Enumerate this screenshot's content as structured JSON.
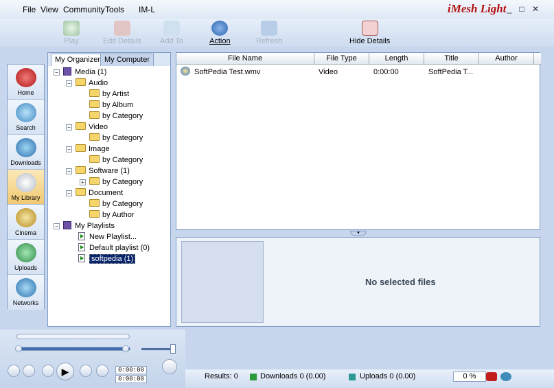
{
  "menu": {
    "file": "File",
    "view": "View",
    "community": "Community",
    "tools": "Tools",
    "iml": "IM-L"
  },
  "brand": "iMesh Light",
  "window": {
    "minimize": "_",
    "maximize": "□",
    "close": "✕"
  },
  "toolbar": {
    "play": "Play",
    "edit_details": "Edit Details",
    "add_to": "Add To",
    "action": "Action",
    "refresh": "Refresh",
    "hide_details": "Hide Details"
  },
  "nav": [
    "Home",
    "Search",
    "Downloads",
    "My Library",
    "Cinema",
    "Uploads",
    "Networks"
  ],
  "tabs": {
    "organizer": "My Organizer",
    "computer": "My Computer"
  },
  "tree": {
    "media": "Media (1)",
    "audio": "Audio",
    "by_artist": "by Artist",
    "by_album": "by Album",
    "by_category": "by Category",
    "video": "Video",
    "image": "Image",
    "software": "Software (1)",
    "document": "Document",
    "by_author": "by Author",
    "playlists": "My Playlists",
    "new_playlist": "New Playlist...",
    "default_playlist": "Default playlist (0)",
    "softpedia": "softpedia (1)"
  },
  "table": {
    "headers": [
      "File Name",
      "File Type",
      "Length",
      "Title",
      "Author"
    ],
    "rows": [
      {
        "name": "SoftPedia Test.wmv",
        "type": "Video",
        "length": "0:00:00",
        "title": "SoftPedia T...",
        "author": ""
      }
    ]
  },
  "details": {
    "no_selection": "No selected files"
  },
  "player": {
    "elapsed": "0:00:00",
    "total": "0:00:00"
  },
  "status": {
    "results": "Results:  0",
    "downloads": "Downloads 0 (0.00)",
    "uploads": "Uploads 0 (0.00)",
    "percent": "0 %"
  },
  "colors": {
    "accent": "#7e9cc6",
    "active_nav": "#f2c971"
  }
}
